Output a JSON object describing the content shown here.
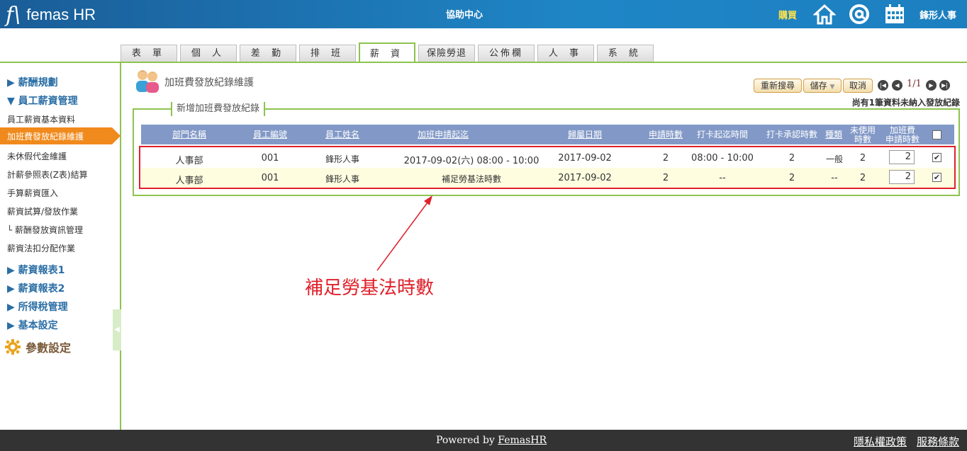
{
  "header": {
    "logo_mark": "f\\",
    "logo_text": "femas HR",
    "center_title": "協助中心",
    "buy_label": "購買",
    "username": "鋒形人事"
  },
  "tabs": [
    "表 單",
    "個 人",
    "差 勤",
    "排 班",
    "薪 資",
    "保險勞退",
    "公佈欄",
    "人 事",
    "系 統"
  ],
  "active_tab": "薪 資",
  "sidebar": {
    "sections": [
      {
        "label": "▶ 薪酬規劃"
      },
      {
        "label": "▼ 員工薪資管理"
      }
    ],
    "items": [
      "員工薪資基本資料",
      "加班費發放紀錄維護",
      "未休假代金維護",
      "計薪參照表(Z表)結算",
      "手算薪資匯入",
      "薪資試算/發放作業",
      "└ 薪酬發放資訊管理",
      "薪資法扣分配作業"
    ],
    "sections2": [
      "▶ 薪資報表1",
      "▶ 薪資報表2",
      "▶ 所得稅管理",
      "▶ 基本設定"
    ],
    "param_label": "參數設定"
  },
  "page": {
    "title": "加班費發放紀錄維護",
    "buttons": {
      "research": "重新搜尋",
      "save": "儲存",
      "save_arrow": "▼",
      "cancel": "取消"
    },
    "page_info": "1/1",
    "notice": "尚有1筆資料未納入發放紀錄",
    "legend": "新增加班費發放紀錄"
  },
  "table": {
    "headers": {
      "dept": "部門名稱",
      "emp_no": "員工編號",
      "emp_name": "員工姓名",
      "ot_period": "加班申請起迄",
      "belong_date": "歸屬日期",
      "apply_hours": "申請時數",
      "punch_period": "打卡起迄時間",
      "punch_hours": "打卡承認時數",
      "type": "種類",
      "unused_1": "未使用",
      "unused_2": "時數",
      "ot_pay_1": "加班費",
      "ot_pay_2": "申請時數"
    },
    "rows": [
      {
        "dept": "人事部",
        "emp_no": "001",
        "emp_name": "鋒形人事",
        "ot_period": "2017-09-02(六) 08:00 - 10:00",
        "belong_date": "2017-09-02",
        "apply_hours": "2",
        "punch_period": "08:00 - 10:00",
        "punch_hours": "2",
        "type": "一般",
        "unused": "2",
        "ot_pay_hours": "2",
        "checked": "✔"
      },
      {
        "dept": "人事部",
        "emp_no": "001",
        "emp_name": "鋒形人事",
        "ot_period": "補足勞基法時數",
        "belong_date": "2017-09-02",
        "apply_hours": "2",
        "punch_period": "--",
        "punch_hours": "2",
        "type": "--",
        "unused": "2",
        "ot_pay_hours": "2",
        "checked": "✔"
      }
    ]
  },
  "annotation": "補足勞基法時數",
  "footer": {
    "powered_prefix": "Powered by ",
    "powered_link": "FemasHR",
    "privacy": "隱私權政策",
    "terms": "服務條款"
  }
}
